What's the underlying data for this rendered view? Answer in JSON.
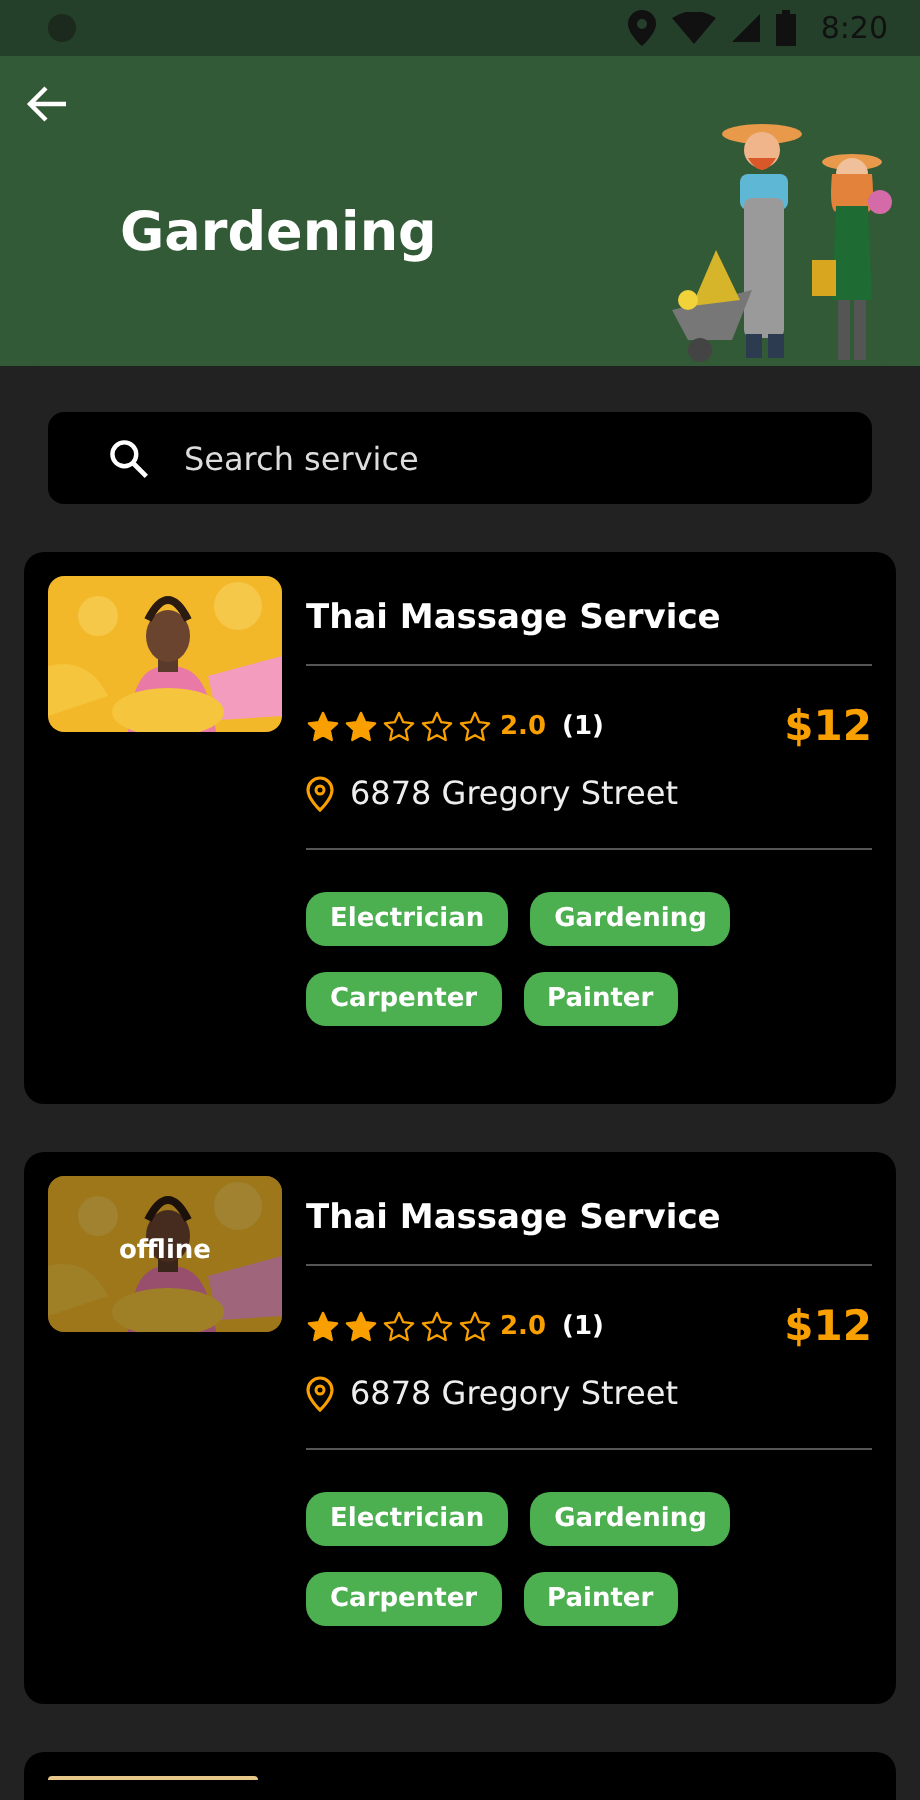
{
  "status_bar": {
    "time": "8:20"
  },
  "header": {
    "title": "Gardening"
  },
  "search": {
    "placeholder": "Search service"
  },
  "services": [
    {
      "title": "Thai Massage Service",
      "stars": 2,
      "rating": "2.0",
      "reviews": "(1)",
      "price": "$12",
      "address": "6878 Gregory Street",
      "offline": false,
      "tags": [
        "Electrician",
        "Gardening",
        "Carpenter",
        "Painter"
      ]
    },
    {
      "title": "Thai Massage Service",
      "stars": 2,
      "rating": "2.0",
      "reviews": "(1)",
      "price": "$12",
      "address": "6878 Gregory Street",
      "offline": true,
      "status_label": "offline",
      "tags": [
        "Electrician",
        "Gardening",
        "Carpenter",
        "Painter"
      ]
    }
  ]
}
